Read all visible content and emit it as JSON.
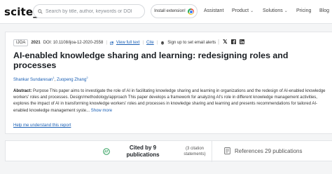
{
  "header": {
    "logo": "scite_",
    "search_placeholder": "Search by title, author, keywords or DOI",
    "install_label": "Install extension!",
    "nav": [
      {
        "label": "Assistant",
        "has_chevron": false
      },
      {
        "label": "Product",
        "has_chevron": true
      },
      {
        "label": "Solutions",
        "has_chevron": true
      },
      {
        "label": "Pricing",
        "has_chevron": false
      },
      {
        "label": "Blog",
        "has_chevron": false
      }
    ]
  },
  "article": {
    "journal_tag": "IJOA",
    "year": "2021",
    "doi": "DOI: 10.1108/ijoa-12-2020-2558",
    "full_text_link": "View full text",
    "cite_link": "Cite",
    "alerts_label": "Sign up to set email alerts",
    "title": "AI-enabled knowledge sharing and learning: redesigning roles and processes",
    "authors": [
      {
        "name": "Shankar Sundaresan",
        "sup": "1"
      },
      {
        "name": "Zuopeng Zhang",
        "sup": "2"
      }
    ],
    "abstract_label": "Abstract:",
    "abstract_text": "Purpose This paper aims to investigate the role of AI in facilitating knowledge sharing and learning in organizations and the redesign of AI-enabled knowledge workers' roles and processes. Design/methodology/approach This paper develops a framework for analyzing AI's role in different knowledge management activities, explores the impact of AI in transforming knowledge workers' roles and processes in knowledge sharing and learning and presents recommendations for tailored AI-enabled knowledge management syste...",
    "show_more": "Show more",
    "help_link": "Help me understand this report"
  },
  "stats": {
    "cited_by": "Cited by 9 publications",
    "citation_statements": "(3 citation statements)",
    "references": "References 29 publications"
  },
  "colors": {
    "link": "#1a5fb4",
    "cite_icon": "#2e9e5b"
  }
}
